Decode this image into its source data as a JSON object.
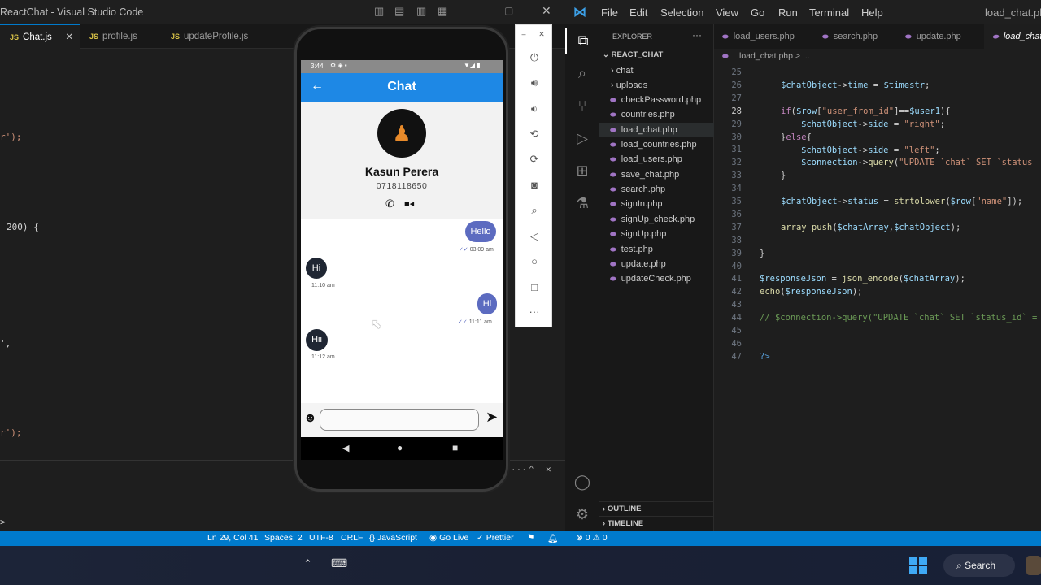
{
  "left_window": {
    "title": "ReactChat - Visual Studio Code",
    "tabs": [
      {
        "label": "Chat.js",
        "icon": "JS"
      },
      {
        "label": "profile.js",
        "icon": "JS"
      },
      {
        "label": "updateProfile.js",
        "icon": "JS"
      }
    ],
    "code_fragments": [
      "r');",
      "200) {",
      "',",
      "r');"
    ],
    "panel_prompt": ">"
  },
  "emulator": {
    "status_time": "3:44",
    "app_title": "Chat",
    "contact_name": "Kasun Perera",
    "contact_phone": "0718118650",
    "messages": [
      {
        "side": "right",
        "text": "Hello",
        "time": "03:09 am"
      },
      {
        "side": "left",
        "text": "Hi",
        "time": "11:10 am"
      },
      {
        "side": "right",
        "text": "Hi",
        "time": "11:11 am"
      },
      {
        "side": "left",
        "text": "Hii",
        "time": "11:12 am"
      }
    ],
    "input_placeholder": "",
    "toolbar_icons": [
      "close-icon",
      "power-icon",
      "volume-up-icon",
      "volume-down-icon",
      "rotate-left-icon",
      "rotate-right-icon",
      "camera-icon",
      "zoom-icon",
      "back-icon",
      "home-icon",
      "overview-icon",
      "more-icon"
    ]
  },
  "right_window": {
    "menu": [
      "File",
      "Edit",
      "Selection",
      "View",
      "Go",
      "Run",
      "Terminal",
      "Help"
    ],
    "title": "load_chat.php",
    "explorer": {
      "header": "EXPLORER",
      "project": "REACT_CHAT",
      "folders": [
        "chat",
        "uploads"
      ],
      "files": [
        "checkPassword.php",
        "countries.php",
        "load_chat.php",
        "load_countries.php",
        "load_users.php",
        "save_chat.php",
        "search.php",
        "signIn.php",
        "signUp_check.php",
        "signUp.php",
        "test.php",
        "update.php",
        "updateCheck.php"
      ],
      "active_file": "load_chat.php",
      "outline": "OUTLINE",
      "timeline": "TIMELINE"
    },
    "tabs": [
      "load_users.php",
      "search.php",
      "update.php",
      "load_chat.php"
    ],
    "breadcrumb": "load_chat.php > ...",
    "line_numbers": [
      "25",
      "26",
      "27",
      "28",
      "29",
      "30",
      "31",
      "32",
      "33",
      "34",
      "35",
      "36",
      "37",
      "38",
      "39",
      "40",
      "41",
      "42",
      "43",
      "44",
      "45",
      "46",
      "47"
    ]
  },
  "statusbar": {
    "position": "Ln 29, Col 41",
    "spaces": "Spaces: 2",
    "encoding": "UTF-8",
    "eol": "CRLF",
    "language": "{} JavaScript",
    "golive": "Go Live",
    "prettier": "Prettier",
    "problems": "⊗ 0 ⚠ 0"
  },
  "taskbar": {
    "search_label": "Search"
  },
  "colors": {
    "accent": "#007acc",
    "appbar": "#1e88e5",
    "bubble_right": "#5c6bc0",
    "bubble_left": "#1f2633"
  }
}
